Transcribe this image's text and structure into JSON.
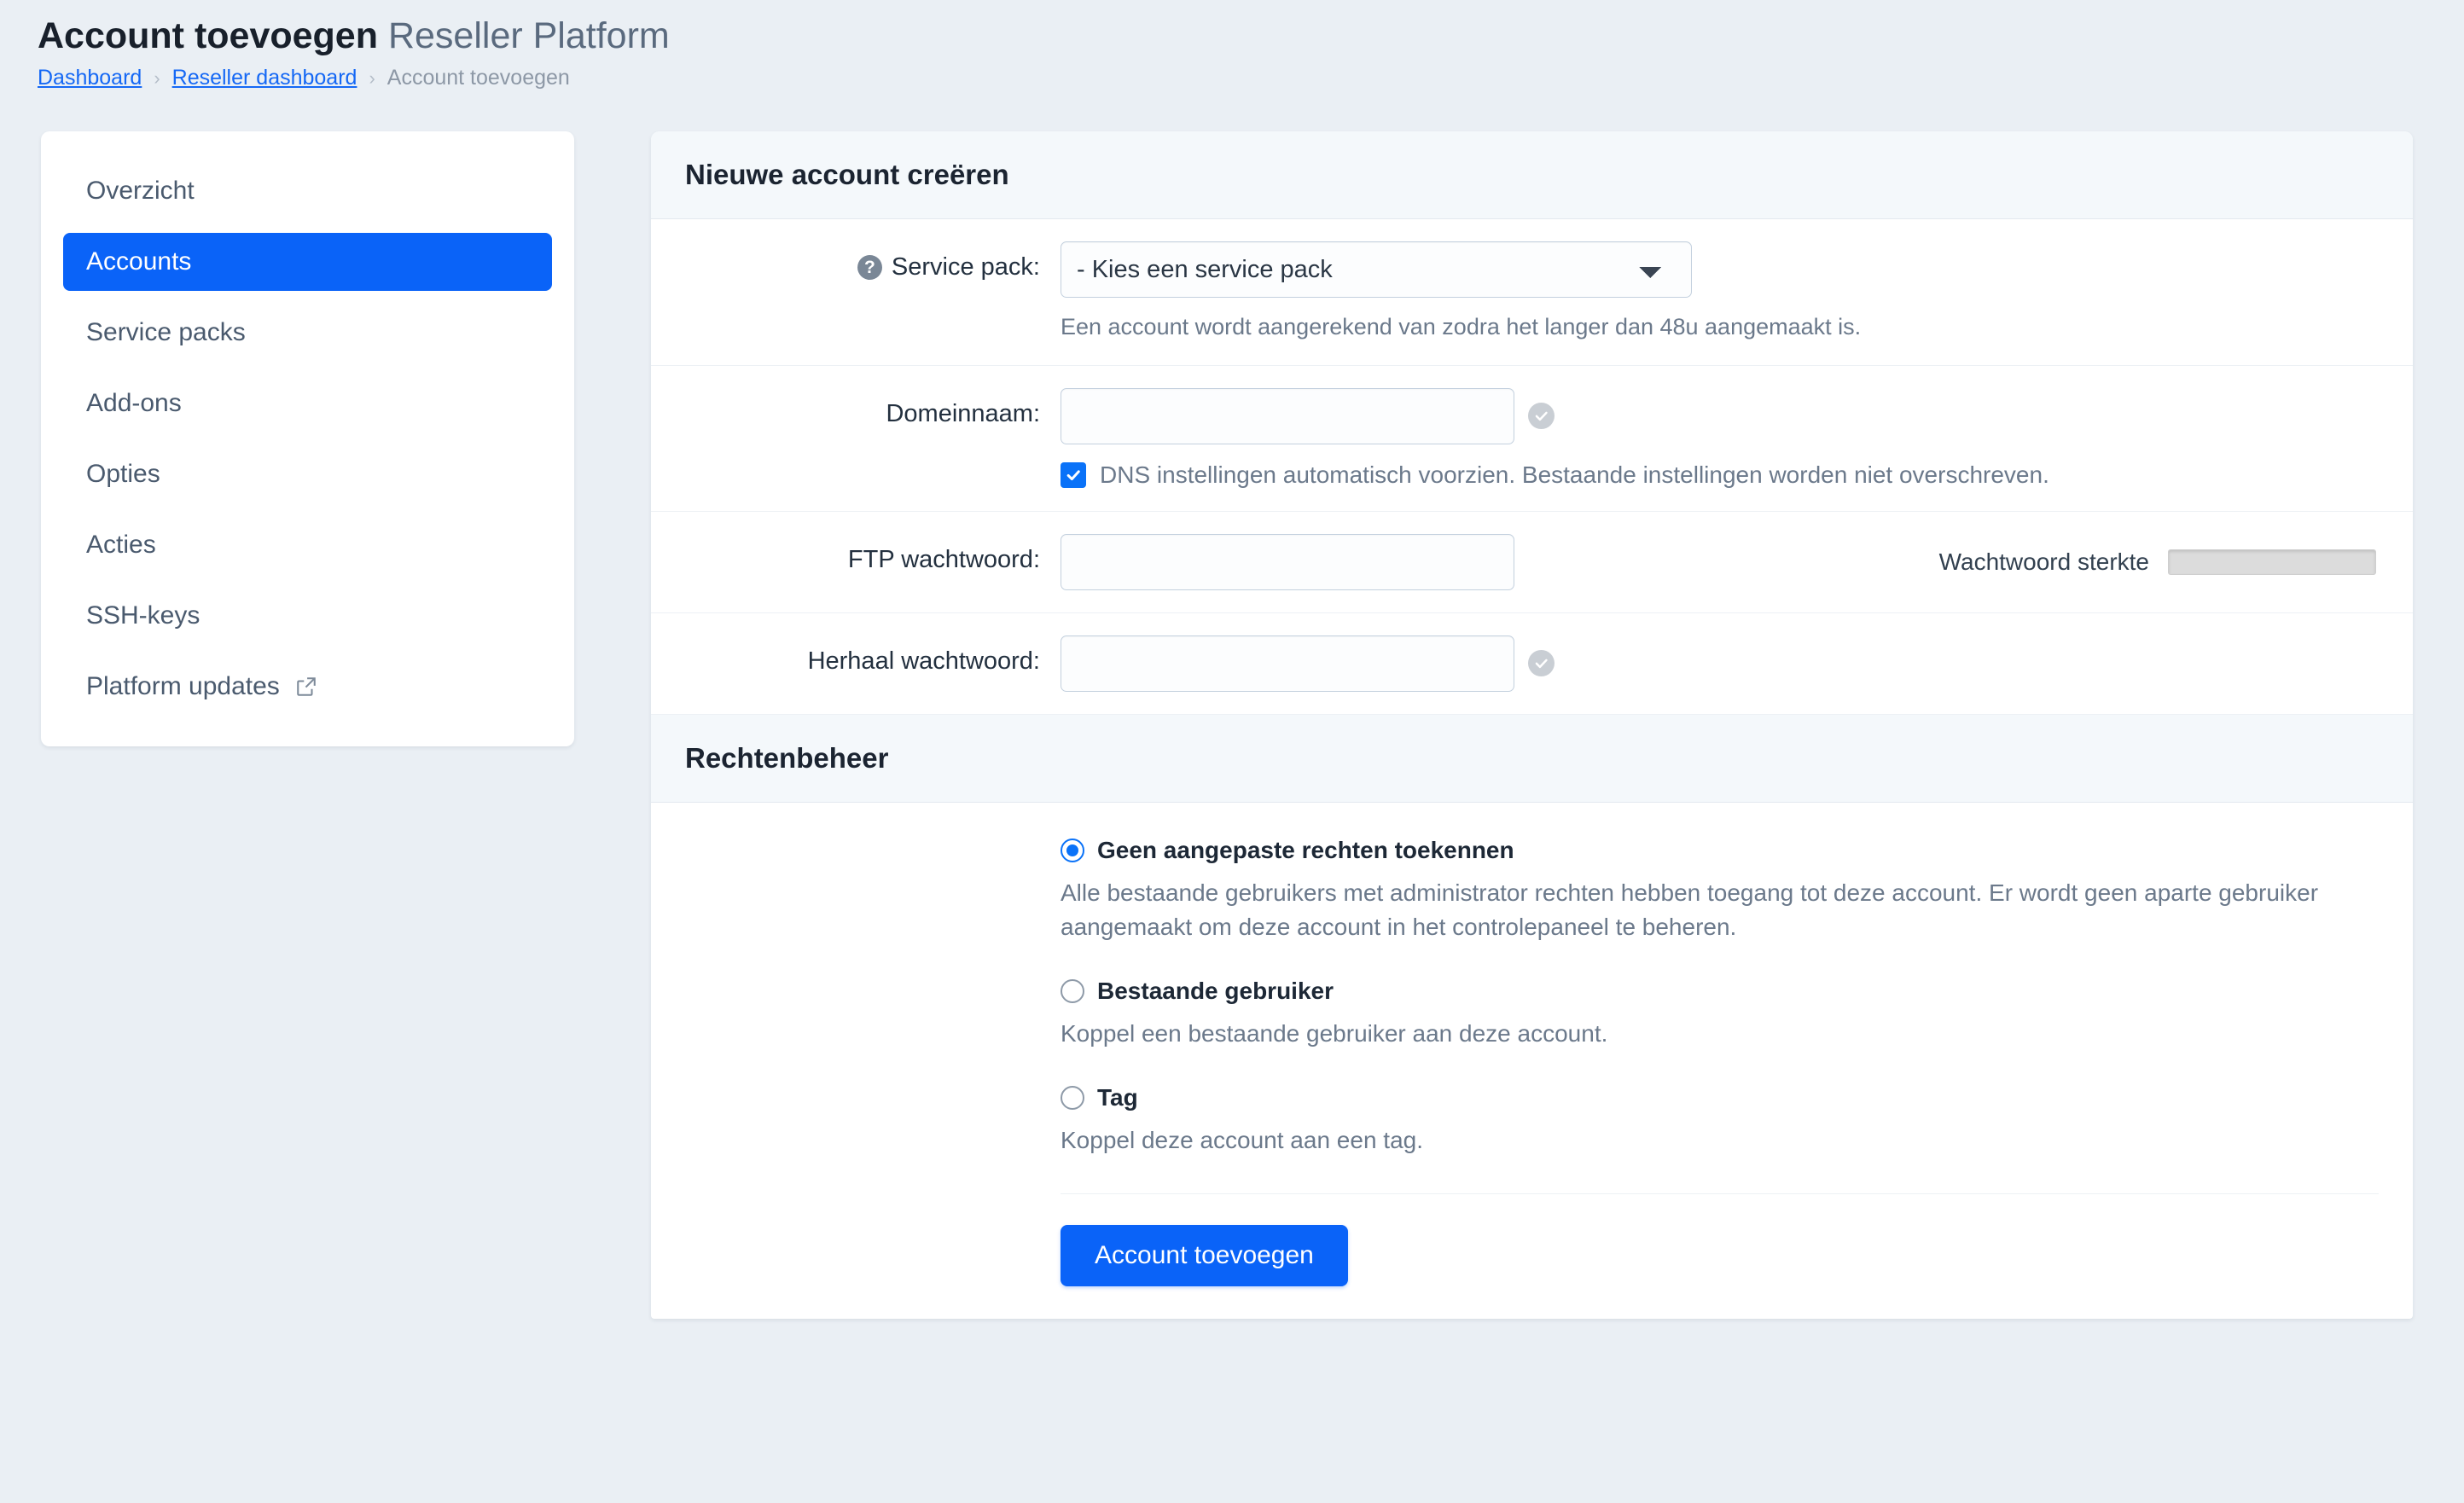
{
  "header": {
    "title_strong": "Account toevoegen",
    "title_light": "Reseller Platform",
    "breadcrumb": {
      "dashboard": "Dashboard",
      "reseller_dashboard": "Reseller dashboard",
      "current": "Account toevoegen",
      "separator": "›"
    }
  },
  "sidebar": {
    "items": [
      {
        "label": "Overzicht",
        "active": false,
        "external": false
      },
      {
        "label": "Accounts",
        "active": true,
        "external": false
      },
      {
        "label": "Service packs",
        "active": false,
        "external": false
      },
      {
        "label": "Add-ons",
        "active": false,
        "external": false
      },
      {
        "label": "Opties",
        "active": false,
        "external": false
      },
      {
        "label": "Acties",
        "active": false,
        "external": false
      },
      {
        "label": "SSH-keys",
        "active": false,
        "external": false
      },
      {
        "label": "Platform updates",
        "active": false,
        "external": true
      }
    ]
  },
  "main": {
    "create_section": {
      "heading": "Nieuwe account creëren",
      "service_pack": {
        "label": "Service pack:",
        "help_glyph": "?",
        "selected": "- Kies een service pack",
        "options": [
          "- Kies een service pack"
        ],
        "hint": "Een account wordt aangerekend van zodra het langer dan 48u aangemaakt is."
      },
      "domain": {
        "label": "Domeinnaam:",
        "value": "",
        "placeholder": "",
        "dns_checkbox": {
          "checked": true,
          "label": "DNS instellingen automatisch voorzien. Bestaande instellingen worden niet overschreven."
        }
      },
      "ftp_password": {
        "label": "FTP wachtwoord:",
        "value": "",
        "placeholder": "",
        "strength_label": "Wachtwoord sterkte",
        "strength_percent": 0
      },
      "repeat_password": {
        "label": "Herhaal wachtwoord:",
        "value": "",
        "placeholder": ""
      }
    },
    "rights_section": {
      "heading": "Rechtenbeheer",
      "options": [
        {
          "label": "Geen aangepaste rechten toekennen",
          "selected": true,
          "description": "Alle bestaande gebruikers met administrator rechten hebben toegang tot deze account. Er wordt geen aparte gebruiker aangemaakt om deze account in het controlepaneel te beheren."
        },
        {
          "label": "Bestaande gebruiker",
          "selected": false,
          "description": "Koppel een bestaande gebruiker aan deze account."
        },
        {
          "label": "Tag",
          "selected": false,
          "description": "Koppel deze account aan een tag."
        }
      ],
      "submit_label": "Account toevoegen"
    }
  },
  "colors": {
    "accent": "#0a63f8",
    "page_bg": "#eaeff4",
    "card_header_bg": "#f4f8fb",
    "muted_text": "#6b798b"
  }
}
